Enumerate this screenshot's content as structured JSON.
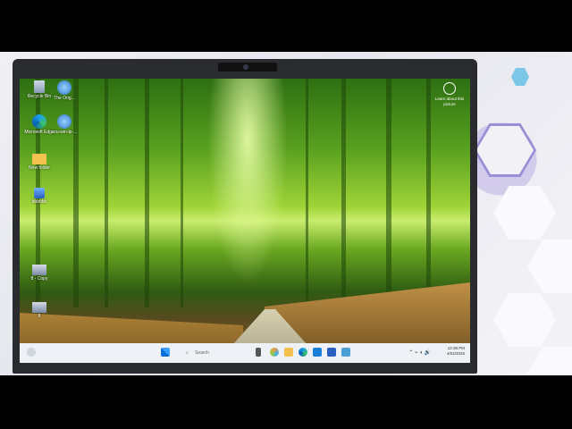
{
  "desktop_icons": [
    {
      "label": "Recycle Bin"
    },
    {
      "label": "The Orig..."
    },
    {
      "label": "Microsoft Edge"
    },
    {
      "label": "ccu-win-lp-..."
    },
    {
      "label": "New folder"
    },
    {
      "label": "bbbbbb"
    },
    {
      "label": "8 - Copy"
    },
    {
      "label": "8"
    }
  ],
  "spotlight": {
    "label": "Learn about this picture"
  },
  "taskbar": {
    "search_placeholder": "Search",
    "time": "12:38 PM",
    "date": "4/02/2025"
  }
}
